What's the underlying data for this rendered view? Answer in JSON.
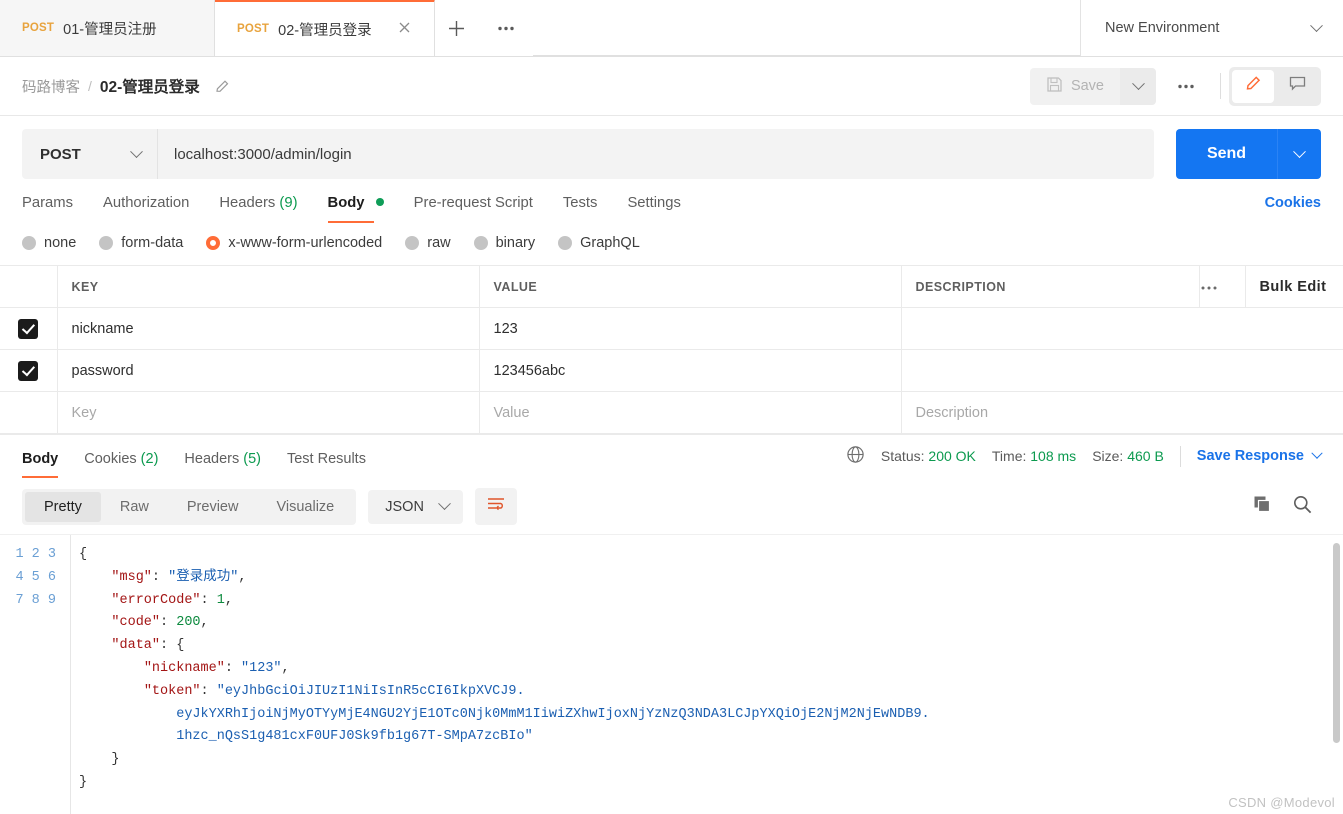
{
  "tabs": [
    {
      "method": "POST",
      "title": "01-管理员注册",
      "active": false
    },
    {
      "method": "POST",
      "title": "02-管理员登录",
      "active": true
    }
  ],
  "tabbar": {
    "new_tab_icon": "plus-icon",
    "tab_options_icon": "ellipsis-icon",
    "environment": "New Environment",
    "environment_caret_icon": "chevron-down-icon"
  },
  "breadcrumb": {
    "collection": "码路博客",
    "separator": "/",
    "request_name": "02-管理员登录",
    "edit_icon": "pencil-icon",
    "save_label": "Save",
    "save_icon": "floppy-disk-icon",
    "save_caret_icon": "chevron-down-icon",
    "more_icon": "ellipsis-icon",
    "comment_icon": "comment-icon"
  },
  "url_row": {
    "method": "POST",
    "method_caret_icon": "chevron-down-icon",
    "url": "localhost:3000/admin/login",
    "send_label": "Send",
    "send_caret_icon": "chevron-down-icon"
  },
  "request_tabs": [
    {
      "label": "Params",
      "active": false,
      "count": "",
      "dot": false
    },
    {
      "label": "Authorization",
      "active": false,
      "count": "",
      "dot": false
    },
    {
      "label": "Headers",
      "active": false,
      "count": "(9)",
      "dot": false
    },
    {
      "label": "Body",
      "active": true,
      "count": "",
      "dot": true
    },
    {
      "label": "Pre-request Script",
      "active": false,
      "count": "",
      "dot": false
    },
    {
      "label": "Tests",
      "active": false,
      "count": "",
      "dot": false
    },
    {
      "label": "Settings",
      "active": false,
      "count": "",
      "dot": false
    }
  ],
  "cookies_link": "Cookies",
  "body_types": [
    {
      "label": "none",
      "selected": false
    },
    {
      "label": "form-data",
      "selected": false
    },
    {
      "label": "x-www-form-urlencoded",
      "selected": true
    },
    {
      "label": "raw",
      "selected": false
    },
    {
      "label": "binary",
      "selected": false
    },
    {
      "label": "GraphQL",
      "selected": false
    }
  ],
  "kv_table": {
    "headers": {
      "key": "KEY",
      "value": "VALUE",
      "description": "DESCRIPTION",
      "options_icon": "ellipsis-icon",
      "bulk_edit": "Bulk Edit"
    },
    "rows": [
      {
        "checked": true,
        "key": "nickname",
        "value": "123",
        "description": ""
      },
      {
        "checked": true,
        "key": "password",
        "value": "123456abc",
        "description": ""
      }
    ],
    "empty_row": {
      "key_placeholder": "Key",
      "value_placeholder": "Value",
      "description_placeholder": "Description"
    }
  },
  "response_tabs": [
    {
      "label": "Body",
      "count": "",
      "active": true
    },
    {
      "label": "Cookies",
      "count": "(2)",
      "active": false
    },
    {
      "label": "Headers",
      "count": "(5)",
      "active": false
    },
    {
      "label": "Test Results",
      "count": "",
      "active": false
    }
  ],
  "response_meta": {
    "globe_icon": "globe-icon",
    "status_label": "Status:",
    "status_value": "200 OK",
    "time_label": "Time:",
    "time_value": "108 ms",
    "size_label": "Size:",
    "size_value": "460 B",
    "save_response": "Save Response",
    "save_response_caret_icon": "chevron-down-icon"
  },
  "response_toolbar": {
    "views": [
      {
        "label": "Pretty",
        "active": true
      },
      {
        "label": "Raw",
        "active": false
      },
      {
        "label": "Preview",
        "active": false
      },
      {
        "label": "Visualize",
        "active": false
      }
    ],
    "format": "JSON",
    "format_caret_icon": "chevron-down-icon",
    "wrap_lines_icon": "wrap-lines-icon",
    "copy_icon": "copy-icon",
    "search_icon": "search-icon"
  },
  "response_body": {
    "language": "json",
    "line_numbers": [
      "1",
      "2",
      "3",
      "4",
      "5",
      "6",
      "7",
      "8",
      "9"
    ],
    "json": {
      "msg": "登录成功",
      "errorCode": 1,
      "code": 200,
      "data": {
        "nickname": "123",
        "token": "eyJhbGciOiJIUzI1NiIsInR5cCI6IkpXVCJ9.eyJkYXRhIjoiNjMyOTYyMjE4NGU2YjE1OTc0Njk0MmM1IiwiZXhwIjoxNjYzNzQ3NDA3LCJpYXQiOjE2NjM2NjEwNDB9.1hzc_nQsS1g481cxF0UFJ0Sk9fb1g67T-SMpA7zcBIo"
      }
    },
    "token_wrapped_lines": [
      "\"eyJhbGciOiJIUzI1NiIsInR5cCI6IkpXVCJ9.",
      "eyJkYXRhIjoiNjMyOTYyMjE4NGU2YjE1OTc0Njk0MmM1IiwiZXhwIjoxNjYzNzQ3NDA3LCJpYXQiOjE2NjM2NjEwNDB9.",
      "1hzc_nQsS1g481cxF0UFJ0Sk9fb1g67T-SMpA7zcBIo\""
    ]
  },
  "watermark": "CSDN @Modevol",
  "colors": {
    "accent_orange": "#ff6c37",
    "send_blue": "#1476f2",
    "link_blue": "#1a73e8",
    "status_green": "#0c9a4f",
    "json_key": "#a31515",
    "json_string": "#1b5fb1",
    "json_number": "#0c8a3e"
  }
}
